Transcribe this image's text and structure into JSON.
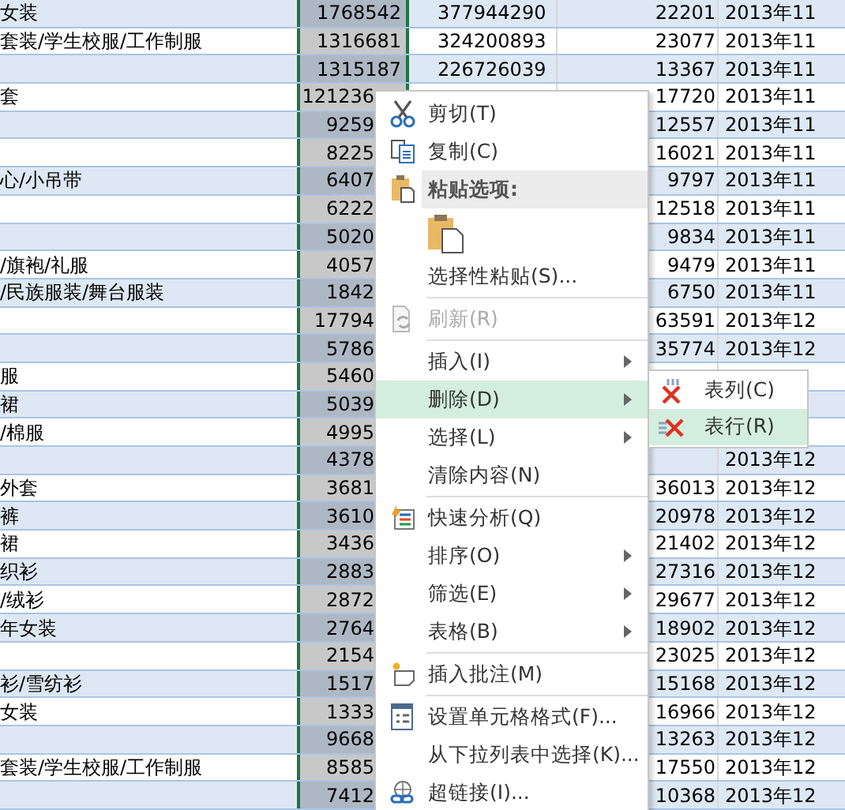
{
  "sheet": {
    "rows": [
      {
        "column_1": "女装",
        "column_2": "1768542",
        "column_3": "377944290",
        "column_4": "22201",
        "column_5": "2013年11"
      },
      {
        "column_1": "套装/学生校服/工作制服",
        "column_2": "1316681",
        "column_3": "324200893",
        "column_4": "23077",
        "column_5": "2013年11"
      },
      {
        "column_2": "1315187",
        "column_3": "226726039",
        "column_4": "13367",
        "column_5": "2013年11"
      },
      {
        "column_1": "套",
        "column_2": "121236",
        "column_4": "17720",
        "column_5": "2013年11"
      },
      {
        "column_2": "9259",
        "column_4": "12557",
        "column_5": "2013年11"
      },
      {
        "column_2": "8225",
        "column_4": "16021",
        "column_5": "2013年11"
      },
      {
        "column_1": "心/小吊带",
        "column_2": "6407",
        "column_4": "9797",
        "column_5": "2013年11"
      },
      {
        "column_2": "6222",
        "column_4": "12518",
        "column_5": "2013年11"
      },
      {
        "column_2": "5020",
        "column_4": "9834",
        "column_5": "2013年11"
      },
      {
        "column_1": "/旗袍/礼服",
        "column_2": "4057",
        "column_4": "9479",
        "column_5": "2013年11"
      },
      {
        "column_1": "/民族服装/舞台服装",
        "column_2": "1842",
        "column_4": "6750",
        "column_5": "2013年11"
      },
      {
        "column_2": "17794",
        "column_4": "63591",
        "column_5": "2013年12"
      },
      {
        "column_2": "5786",
        "column_4": "35774",
        "column_5": "2013年12"
      },
      {
        "column_1": "服",
        "column_2": "5460"
      },
      {
        "column_1": "裙",
        "column_2": "5039"
      },
      {
        "column_1": "/棉服",
        "column_2": "4995"
      },
      {
        "column_2": "4378",
        "column_5": "2013年12"
      },
      {
        "column_1": "外套",
        "column_2": "3681",
        "column_4": "36013",
        "column_5": "2013年12"
      },
      {
        "column_1": "裤",
        "column_2": "3610",
        "column_4": "20978",
        "column_5": "2013年12"
      },
      {
        "column_1": "裙",
        "column_2": "3436",
        "column_4": "21402",
        "column_5": "2013年12"
      },
      {
        "column_1": "织衫",
        "column_2": "2883",
        "column_4": "27316",
        "column_5": "2013年12"
      },
      {
        "column_1": "/绒衫",
        "column_2": "2872",
        "column_4": "29677",
        "column_5": "2013年12"
      },
      {
        "column_1": "年女装",
        "column_2": "2764",
        "column_4": "18902",
        "column_5": "2013年12"
      },
      {
        "column_2": "2154",
        "column_4": "23025",
        "column_5": "2013年12"
      },
      {
        "column_1": "衫/雪纺衫",
        "column_2": "1517",
        "column_4": "15168",
        "column_5": "2013年12"
      },
      {
        "column_1": "女装",
        "column_2": "1333",
        "column_4": "16966",
        "column_5": "2013年12"
      },
      {
        "column_2": "9668",
        "column_4": "13263",
        "column_5": "2013年12"
      },
      {
        "column_1": "套装/学生校服/工作制服",
        "column_2": "8585",
        "column_4": "17550",
        "column_5": "2013年12"
      },
      {
        "column_2": "7412",
        "column_4": "10368",
        "column_5": "2013年12"
      }
    ]
  },
  "context_menu": {
    "items": [
      {
        "kind": "command",
        "label": "剪切(T)",
        "disabled": false,
        "selected": false,
        "has_submenu": false
      },
      {
        "kind": "command",
        "label": "复制(C)",
        "disabled": false,
        "selected": false,
        "has_submenu": false
      },
      {
        "kind": "header",
        "label": "粘贴选项:"
      },
      {
        "kind": "paste_option"
      },
      {
        "kind": "command",
        "label": "选择性粘贴(S)...",
        "disabled": false,
        "selected": false,
        "has_submenu": false
      },
      {
        "kind": "separator"
      },
      {
        "kind": "command",
        "label": "刷新(R)",
        "disabled": true,
        "selected": false,
        "has_submenu": false
      },
      {
        "kind": "separator"
      },
      {
        "kind": "command",
        "label": "插入(I)",
        "disabled": false,
        "selected": false,
        "has_submenu": true
      },
      {
        "kind": "command",
        "label": "删除(D)",
        "disabled": false,
        "selected": true,
        "has_submenu": true
      },
      {
        "kind": "command",
        "label": "选择(L)",
        "disabled": false,
        "selected": false,
        "has_submenu": true
      },
      {
        "kind": "command",
        "label": "清除内容(N)",
        "disabled": false,
        "selected": false,
        "has_submenu": false
      },
      {
        "kind": "separator"
      },
      {
        "kind": "command",
        "label": "快速分析(Q)",
        "disabled": false,
        "selected": false,
        "has_submenu": false
      },
      {
        "kind": "command",
        "label": "排序(O)",
        "disabled": false,
        "selected": false,
        "has_submenu": true
      },
      {
        "kind": "command",
        "label": "筛选(E)",
        "disabled": false,
        "selected": false,
        "has_submenu": true
      },
      {
        "kind": "command",
        "label": "表格(B)",
        "disabled": false,
        "selected": false,
        "has_submenu": true
      },
      {
        "kind": "separator"
      },
      {
        "kind": "command",
        "label": "插入批注(M)",
        "disabled": false,
        "selected": false,
        "has_submenu": false
      },
      {
        "kind": "separator"
      },
      {
        "kind": "command",
        "label": "设置单元格格式(F)...",
        "disabled": false,
        "selected": false,
        "has_submenu": false
      },
      {
        "kind": "command",
        "label": "从下拉列表中选择(K)...",
        "disabled": false,
        "selected": false,
        "has_submenu": false
      },
      {
        "kind": "command",
        "label": "超链接(I)...",
        "disabled": false,
        "selected": false,
        "has_submenu": false
      }
    ]
  },
  "submenu": {
    "items": [
      {
        "label": "表列(C)",
        "selected": false
      },
      {
        "label": "表行(R)",
        "selected": true
      }
    ]
  }
}
